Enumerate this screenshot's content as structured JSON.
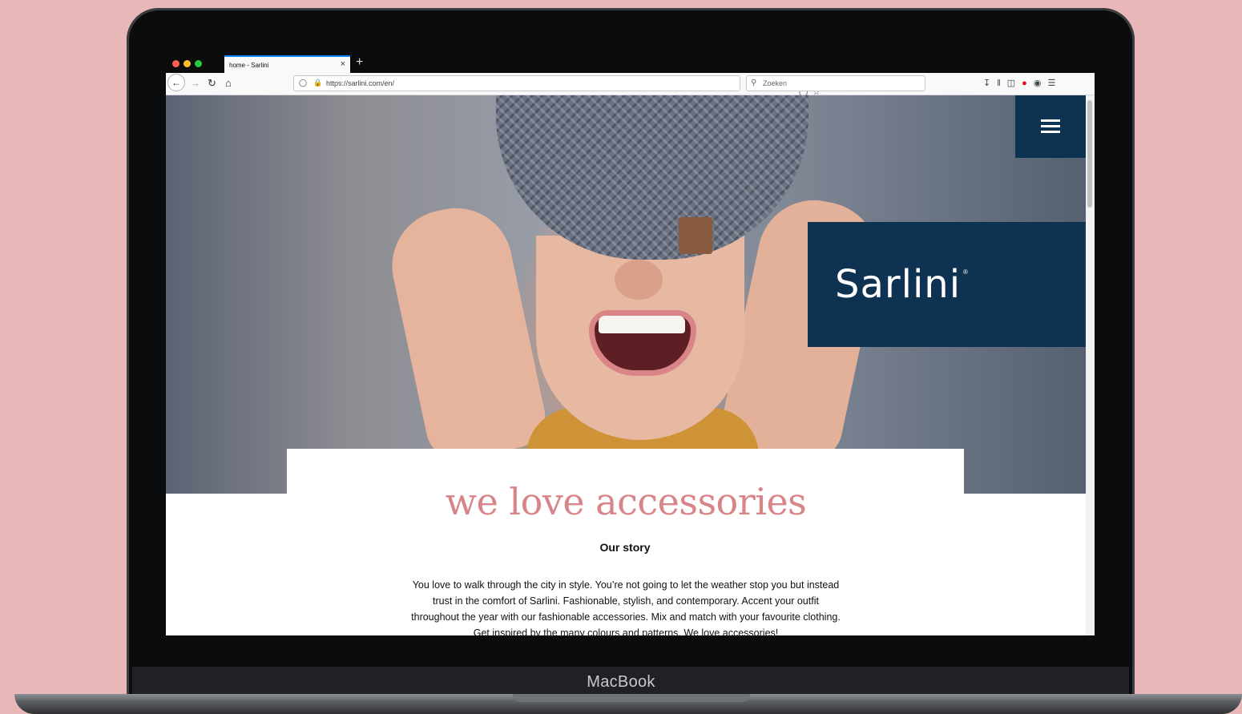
{
  "device": {
    "brand_label": "MacBook"
  },
  "browser": {
    "tab": {
      "title": "home - Sarlini",
      "close": "×"
    },
    "new_tab": "+",
    "url": "https://sarlini.com/en/",
    "search_placeholder": "Zoeken",
    "nav_icons": [
      "back-icon",
      "forward-icon",
      "reload-icon",
      "home-icon"
    ],
    "url_actions": [
      "reader-icon",
      "more-icon",
      "pocket-icon",
      "bookmark-star-icon"
    ],
    "toolbar_icons": [
      "download-icon",
      "library-icon",
      "sidebar-icon",
      "pinterest-icon",
      "account-icon",
      "menu-icon"
    ]
  },
  "site": {
    "logo": "Sarlini",
    "logo_reg": "®",
    "headline": "we love accessories",
    "subheading": "Our story",
    "story": "You love to walk through the city in style. You’re not going to let the weather stop you but instead trust in the comfort of Sarlini. Fashionable, stylish, and contemporary. Accent your outfit throughout the year with our fashionable accessories. Mix and match with your favourite clothing. Get inspired by the many colours and patterns. We love accessories!"
  },
  "colors": {
    "background": "#e8b7b7",
    "brand_navy": "#0e3352",
    "headline_pink": "#d88589",
    "tab_accent": "#0a84ff"
  }
}
